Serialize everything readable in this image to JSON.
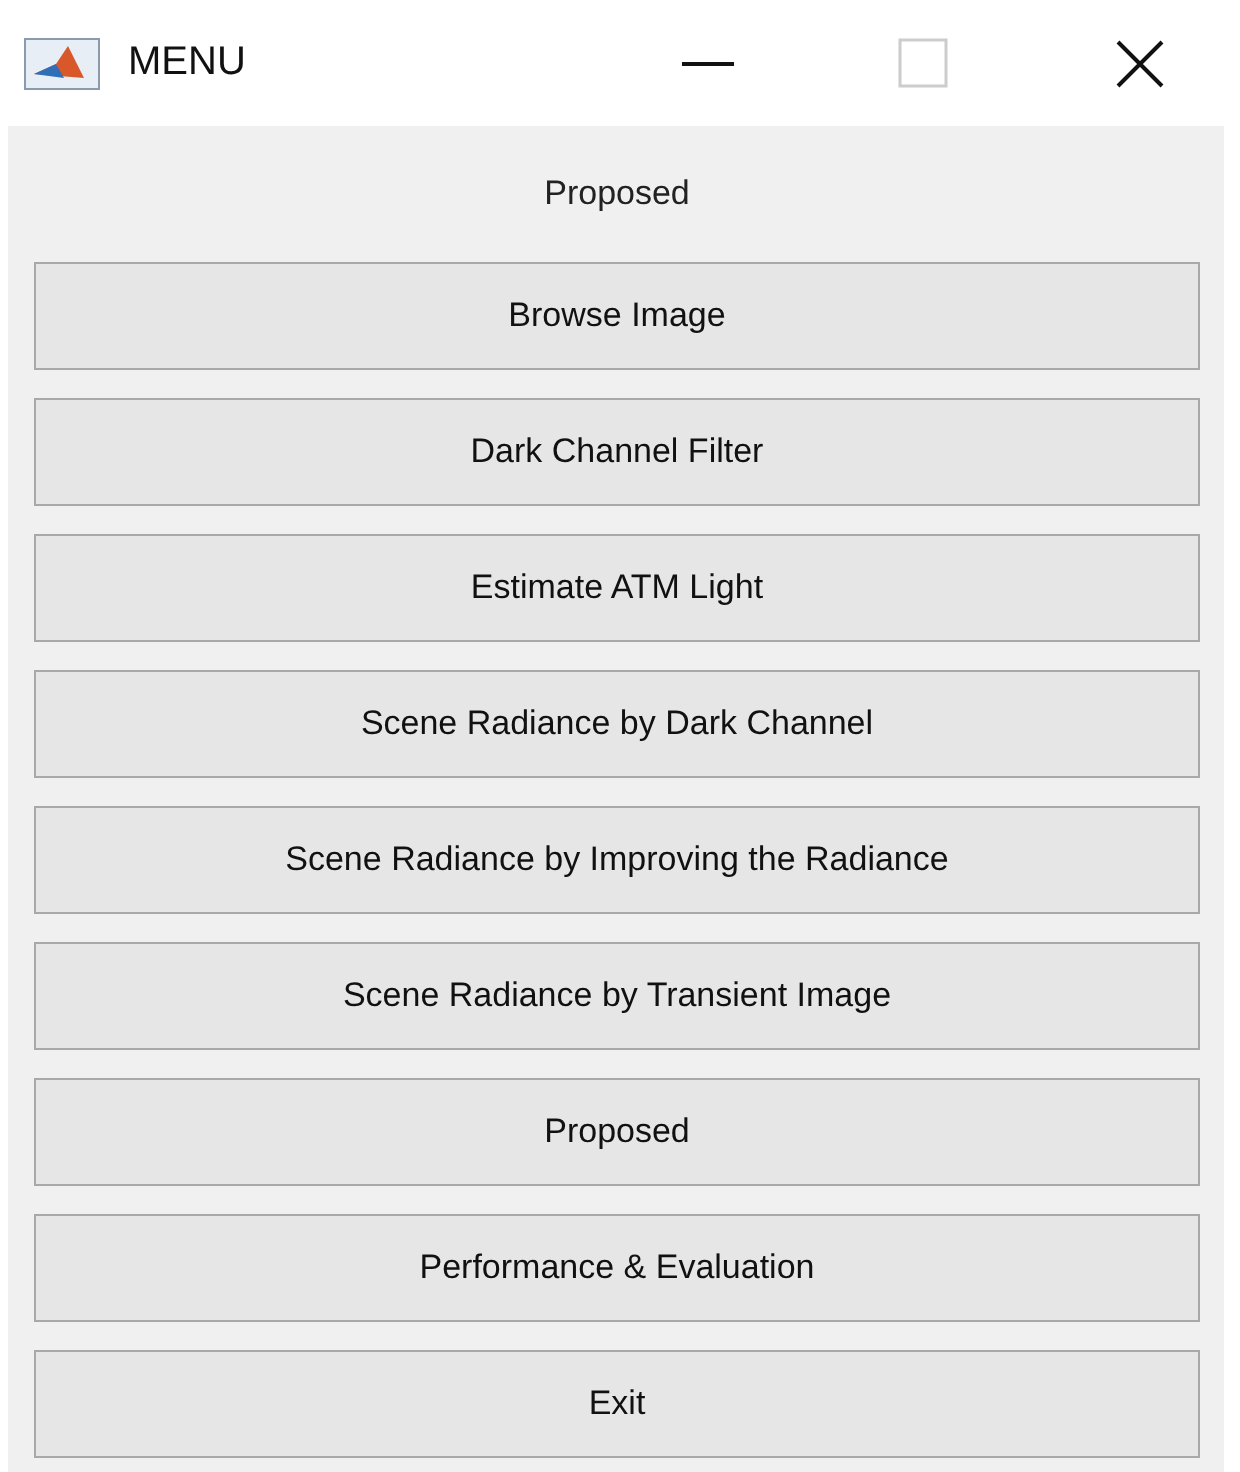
{
  "window": {
    "title": "MENU"
  },
  "heading": "Proposed",
  "buttons": [
    "Browse Image",
    "Dark Channel Filter",
    "Estimate ATM Light",
    "Scene Radiance by Dark Channel",
    "Scene Radiance by Improving the Radiance",
    "Scene Radiance by Transient Image",
    "Proposed",
    "Performance & Evaluation",
    "Exit"
  ]
}
